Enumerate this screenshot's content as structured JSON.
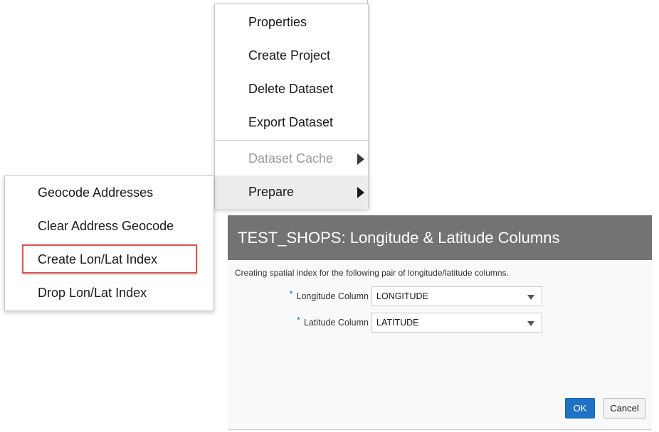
{
  "context_menu": {
    "items": [
      {
        "label": "Properties"
      },
      {
        "label": "Create Project"
      },
      {
        "label": "Delete Dataset"
      },
      {
        "label": "Export Dataset"
      }
    ],
    "submenus": [
      {
        "label": "Dataset Cache",
        "state": "disabled"
      },
      {
        "label": "Prepare",
        "state": "active"
      }
    ]
  },
  "prepare_submenu": {
    "items": [
      {
        "label": "Geocode Addresses"
      },
      {
        "label": "Clear Address Geocode"
      },
      {
        "label": "Create Lon/Lat Index",
        "highlighted": true
      },
      {
        "label": "Drop Lon/Lat Index"
      }
    ],
    "highlight_color": "#d9534f"
  },
  "dialog": {
    "title": "TEST_SHOPS: Longitude & Latitude Columns",
    "description": "Creating spatial index for the following pair of longitude/latitude columns.",
    "fields": [
      {
        "label": "Longitude Column",
        "required_mark": "*",
        "value": "LONGITUDE"
      },
      {
        "label": "Latitude Column",
        "required_mark": "*",
        "value": "LATITUDE"
      }
    ],
    "ok_label": "OK",
    "cancel_label": "Cancel",
    "header_color": "#737373",
    "ok_color": "#1f73c5"
  }
}
